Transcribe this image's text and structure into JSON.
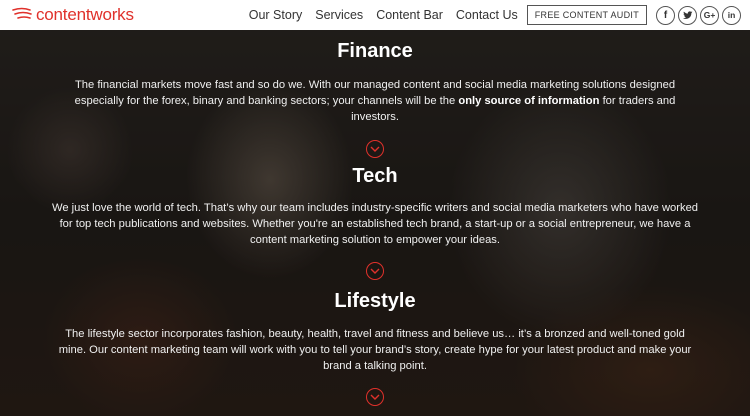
{
  "brand": {
    "name": "contentworks",
    "accent_color": "#e0312b"
  },
  "nav": {
    "items": [
      {
        "label": "Our Story"
      },
      {
        "label": "Services"
      },
      {
        "label": "Content Bar"
      },
      {
        "label": "Contact Us"
      }
    ],
    "cta_label": "FREE CONTENT AUDIT",
    "social": [
      {
        "icon": "facebook-icon",
        "glyph": "f"
      },
      {
        "icon": "twitter-icon",
        "glyph": "🐦"
      },
      {
        "icon": "google-plus-icon",
        "glyph": "G+"
      },
      {
        "icon": "linkedin-icon",
        "glyph": "in"
      }
    ]
  },
  "sections": [
    {
      "title": "Finance",
      "text_before": "The financial markets move fast and so do we. With our managed content and social media marketing solutions designed especially for the forex, binary and banking sectors; your channels will be the ",
      "text_bold": "only source of information",
      "text_after": " for traders and investors."
    },
    {
      "title": "Tech",
      "text": "We just love the world of tech. That’s why our team includes industry-specific writers and social media marketers who have worked for top tech publications and websites. Whether you're an established tech brand, a start-up or a social entrepreneur, we have a content marketing solution to empower your ideas."
    },
    {
      "title": "Lifestyle",
      "text": "The lifestyle sector incorporates fashion, beauty, health, travel and fitness and believe us… it’s a bronzed and well-toned gold mine. Our content marketing team will work with you to tell your brand’s story, create hype for your latest product and make your brand a talking point."
    }
  ]
}
